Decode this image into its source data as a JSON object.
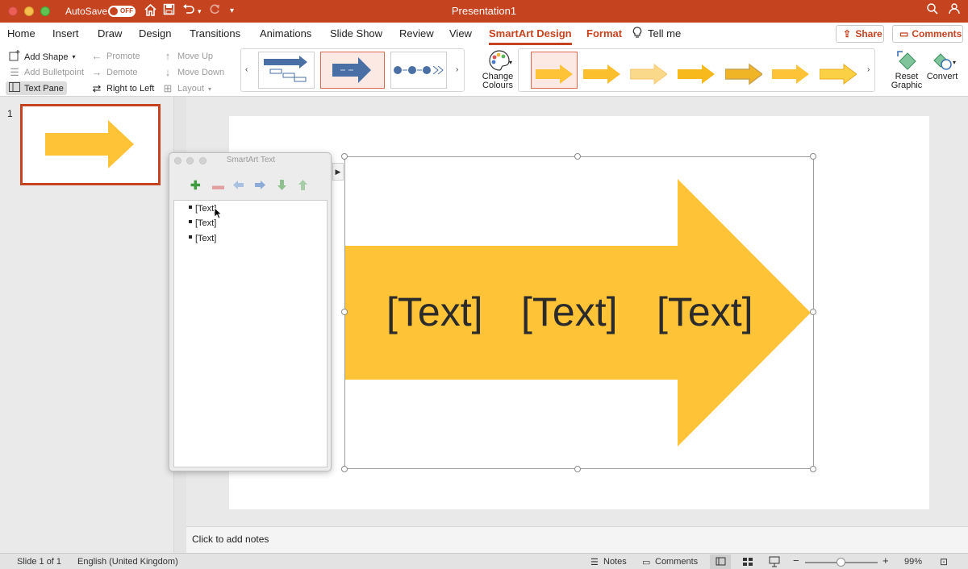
{
  "window": {
    "title": "Presentation1",
    "autosave_label": "AutoSave",
    "autosave_state": "OFF"
  },
  "tabs": [
    {
      "label": "Home"
    },
    {
      "label": "Insert"
    },
    {
      "label": "Draw"
    },
    {
      "label": "Design"
    },
    {
      "label": "Transitions"
    },
    {
      "label": "Animations"
    },
    {
      "label": "Slide Show"
    },
    {
      "label": "Review"
    },
    {
      "label": "View"
    },
    {
      "label": "SmartArt Design",
      "active": true
    },
    {
      "label": "Format"
    },
    {
      "label": "Tell me"
    }
  ],
  "actions": {
    "share": "Share",
    "comments": "Comments"
  },
  "ribbon": {
    "add_shape": "Add Shape",
    "add_bulletpoint": "Add Bulletpoint",
    "text_pane": "Text Pane",
    "promote": "Promote",
    "demote": "Demote",
    "right_to_left": "Right to Left",
    "move_up": "Move Up",
    "move_down": "Move Down",
    "layout": "Layout",
    "change_colours": [
      "Change",
      "Colours"
    ],
    "reset_graphic": [
      "Reset",
      "Graphic"
    ],
    "convert": "Convert"
  },
  "colors": {
    "accent": "#c5431f",
    "arrow_fill": "#fec337",
    "smartart_blue": "#4a6fa5"
  },
  "thumbnails": [
    {
      "number": "1"
    }
  ],
  "smartart_pane": {
    "title": "SmartArt Text",
    "items": [
      "[Text]",
      "[Text]",
      "[Text]"
    ]
  },
  "slide": {
    "texts": [
      "[Text]",
      "[Text]",
      "[Text]"
    ]
  },
  "notes": {
    "placeholder": "Click to add notes"
  },
  "status": {
    "slide_counter": "Slide 1 of 1",
    "language": "English (United Kingdom)",
    "notes": "Notes",
    "comments": "Comments",
    "zoom": "99%"
  }
}
